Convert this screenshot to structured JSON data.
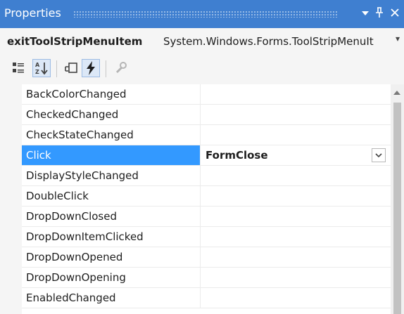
{
  "panel": {
    "title": "Properties",
    "pin_glyph": "ह",
    "close_glyph": "×"
  },
  "selected_object": {
    "name": "exitToolStripMenuItem",
    "type": "System.Windows.Forms.ToolStripMenuIt"
  },
  "toolbar": {
    "buttons": [
      {
        "name": "categorized-icon",
        "active": false
      },
      {
        "name": "alphabetical-icon",
        "active": true
      },
      {
        "name": "properties-icon",
        "active": false
      },
      {
        "name": "events-icon",
        "active": true
      },
      {
        "name": "property-pages-icon",
        "active": false
      }
    ]
  },
  "events": [
    {
      "name": "BackColorChanged",
      "value": ""
    },
    {
      "name": "CheckedChanged",
      "value": ""
    },
    {
      "name": "CheckStateChanged",
      "value": ""
    },
    {
      "name": "Click",
      "value": "FormClose",
      "selected": true
    },
    {
      "name": "DisplayStyleChanged",
      "value": ""
    },
    {
      "name": "DoubleClick",
      "value": ""
    },
    {
      "name": "DropDownClosed",
      "value": ""
    },
    {
      "name": "DropDownItemClicked",
      "value": ""
    },
    {
      "name": "DropDownOpened",
      "value": ""
    },
    {
      "name": "DropDownOpening",
      "value": ""
    },
    {
      "name": "EnabledChanged",
      "value": ""
    }
  ],
  "colors": {
    "title_bar": "#3f7fd0",
    "selection": "#3399ff",
    "gutter": "#f5f5f5"
  }
}
